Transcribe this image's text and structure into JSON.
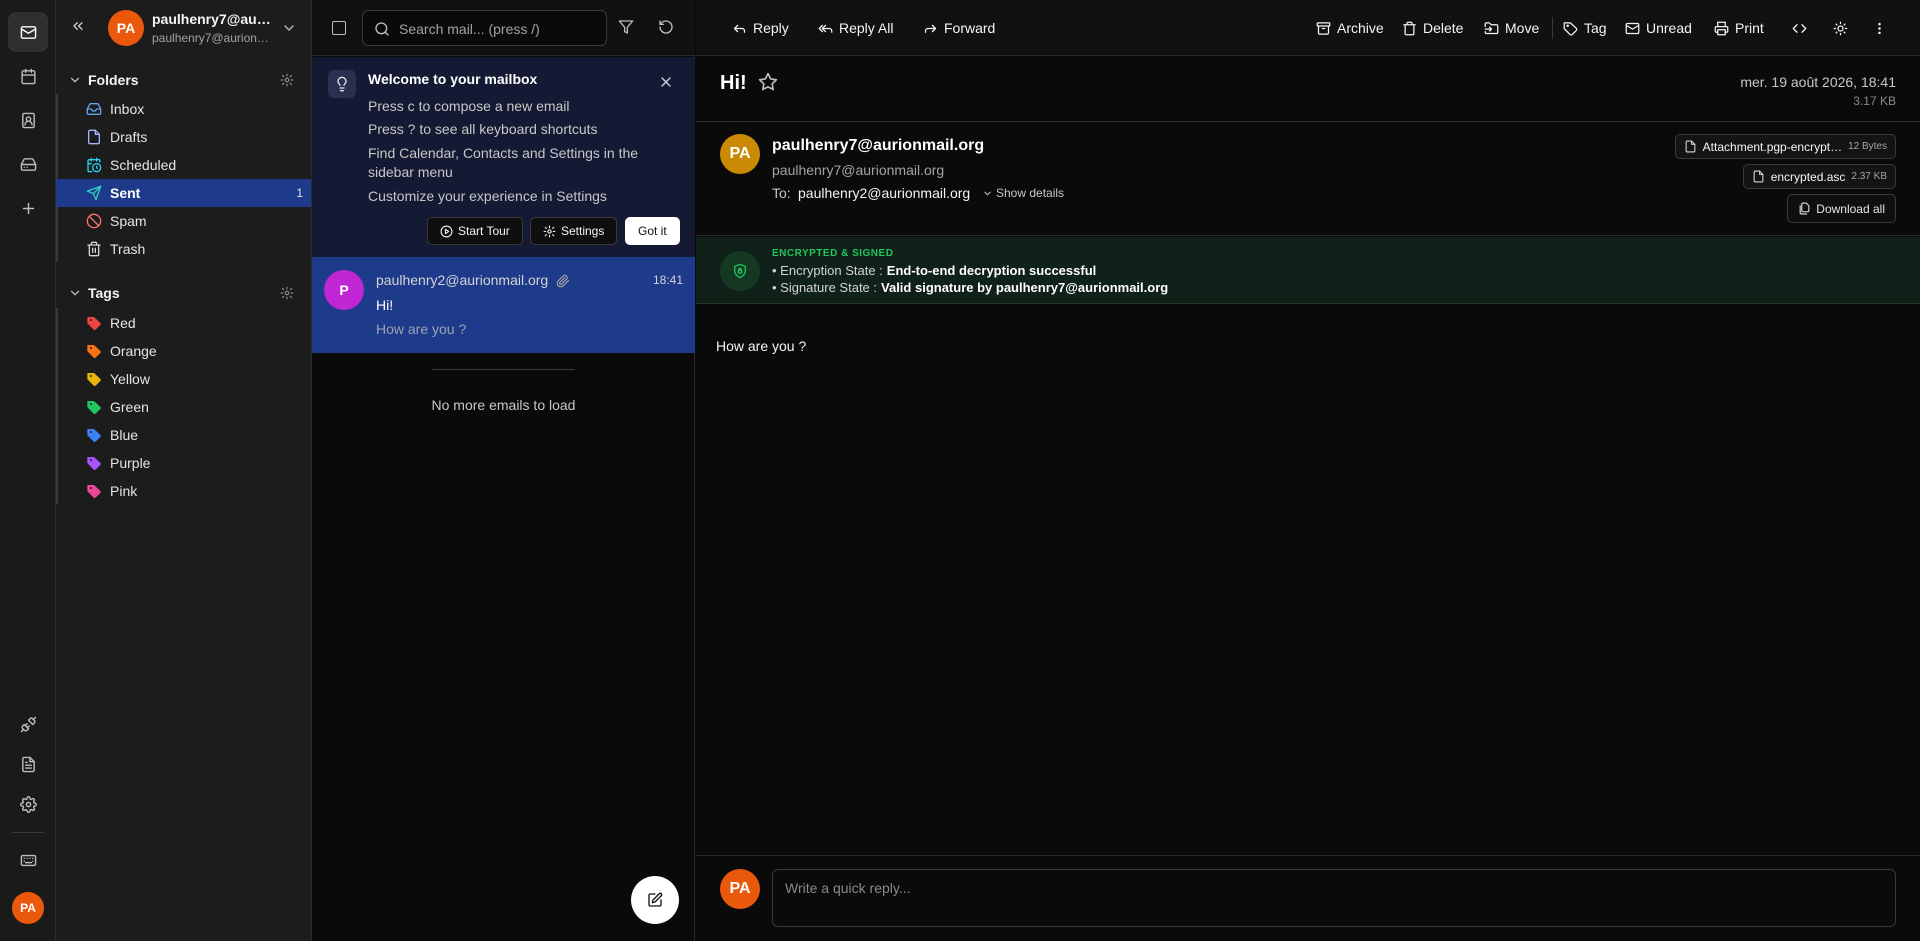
{
  "account": {
    "initials": "PA",
    "name": "paulhenry7@aurionmail.org",
    "email": "paulhenry7@aurionmail.org"
  },
  "folders": {
    "title": "Folders",
    "items": [
      {
        "label": "Inbox",
        "icon": "inbox-icon",
        "color": "#60a5fa"
      },
      {
        "label": "Drafts",
        "icon": "file-icon",
        "color": "#a5b4fc"
      },
      {
        "label": "Scheduled",
        "icon": "calendar-clock-icon",
        "color": "#22d3ee"
      },
      {
        "label": "Sent",
        "icon": "send-icon",
        "color": "#2dd4bf",
        "count": "1",
        "active": true
      },
      {
        "label": "Spam",
        "icon": "ban-icon",
        "color": "#f87171"
      },
      {
        "label": "Trash",
        "icon": "trash-icon",
        "color": "#d4d4d4"
      }
    ]
  },
  "tags": {
    "title": "Tags",
    "items": [
      {
        "label": "Red",
        "color": "#ef4444"
      },
      {
        "label": "Orange",
        "color": "#f97316"
      },
      {
        "label": "Yellow",
        "color": "#eab308"
      },
      {
        "label": "Green",
        "color": "#22c55e"
      },
      {
        "label": "Blue",
        "color": "#3b82f6"
      },
      {
        "label": "Purple",
        "color": "#a855f7"
      },
      {
        "label": "Pink",
        "color": "#ec4899"
      }
    ]
  },
  "search": {
    "placeholder": "Search mail... (press /)"
  },
  "welcome": {
    "title": "Welcome to your mailbox",
    "lines": [
      "Press c to compose a new email",
      "Press ? to see all keyboard shortcuts",
      "Find Calendar, Contacts and Settings in the sidebar menu",
      "Customize your experience in Settings"
    ],
    "start_tour": "Start Tour",
    "settings": "Settings",
    "got_it": "Got it"
  },
  "mail_list": {
    "items": [
      {
        "avatar": "P",
        "from": "paulhenry2@aurionmail.org",
        "time": "18:41",
        "subject": "Hi!",
        "preview": "How are you ?"
      }
    ],
    "no_more": "No more emails to load"
  },
  "toolbar": {
    "reply": "Reply",
    "reply_all": "Reply All",
    "forward": "Forward",
    "archive": "Archive",
    "delete": "Delete",
    "move": "Move",
    "tag": "Tag",
    "unread": "Unread",
    "print": "Print"
  },
  "message": {
    "subject": "Hi!",
    "date": "mer. 19 août 2026, 18:41",
    "size": "3.17 KB",
    "sender_initials": "PA",
    "sender_name": "paulhenry7@aurionmail.org",
    "sender_email": "paulhenry7@aurionmail.org",
    "to_label": "To:",
    "to": "paulhenry2@aurionmail.org",
    "show_details": "Show details",
    "attachments": [
      {
        "name": "Attachment.pgp-encrypt…",
        "size": "12 Bytes"
      },
      {
        "name": "encrypted.asc",
        "size": "2.37 KB"
      }
    ],
    "download_all": "Download all",
    "encryption": {
      "title": "ENCRYPTED & SIGNED",
      "enc_label": "• Encryption State :",
      "enc_value": "End-to-end decryption successful",
      "sig_label": "• Signature State :",
      "sig_value": "Valid signature by paulhenry7@aurionmail.org"
    },
    "body": "How are you ?"
  },
  "quick_reply": {
    "initials": "PA",
    "placeholder": "Write a quick reply..."
  }
}
